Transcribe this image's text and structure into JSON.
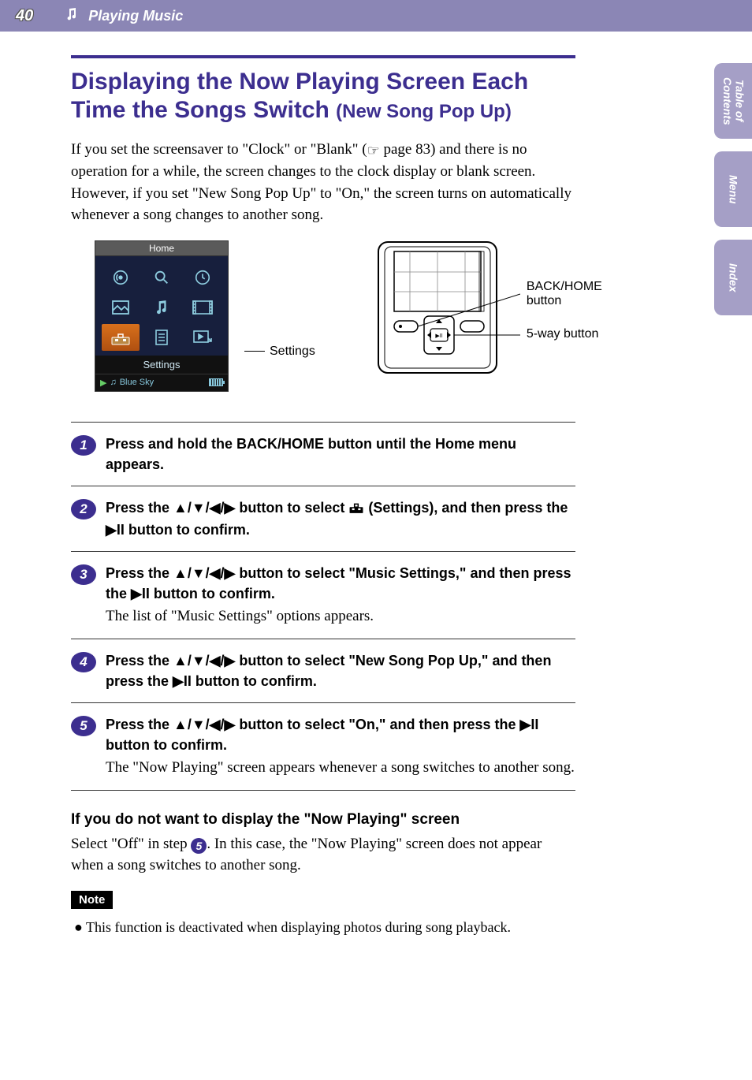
{
  "header": {
    "page_number": "40",
    "section_title": "Playing Music"
  },
  "side_tabs": {
    "toc": "Table of\nContents",
    "menu": "Menu",
    "index": "Index"
  },
  "title": {
    "main": "Displaying the Now Playing Screen Each Time the Songs Switch ",
    "sub": "(New Song Pop Up)"
  },
  "intro_a": "If you set the screensaver to \"Clock\" or \"Blank\" (",
  "intro_page_ref": " page 83",
  "intro_b": ") and there is no operation for a while, the screen changes to the clock display or blank screen. However, if you set \"New Song Pop Up\" to \"On,\" the screen turns on automatically whenever a song changes to another song.",
  "home_screen": {
    "top_label": "Home",
    "selected_label": "Settings",
    "status_track": "Blue Sky"
  },
  "callouts": {
    "settings": "Settings",
    "back_home_a": "BACK/HOME",
    "back_home_b": "button",
    "five_way": "5-way button"
  },
  "steps": [
    {
      "num": "1",
      "bold": "Press and hold the BACK/HOME button until the Home menu appears.",
      "regular": ""
    },
    {
      "num": "2",
      "bold_pre": "Press the ",
      "bold_mid": " button to select ",
      "bold_post": " (Settings), and then press the ",
      "bold_end": " button to confirm.",
      "regular": ""
    },
    {
      "num": "3",
      "bold_pre": "Press the ",
      "bold_mid": " button to select \"Music Settings,\" and then press the ",
      "bold_end": " button to confirm.",
      "regular": "The list of \"Music Settings\" options appears."
    },
    {
      "num": "4",
      "bold_pre": "Press the ",
      "bold_mid": " button to select \"New Song Pop Up,\" and then press the ",
      "bold_end": " button to confirm.",
      "regular": ""
    },
    {
      "num": "5",
      "bold_pre": "Press the ",
      "bold_mid": " button to select \"On,\" and then press the ",
      "bold_end": " button to confirm.",
      "regular": "The \"Now Playing\" screen appears whenever a song switches to another song."
    }
  ],
  "sub_section": {
    "heading": "If you do not want to display the \"Now Playing\" screen",
    "para_a": "Select \"Off\" in step ",
    "para_step": "5",
    "para_b": ". In this case, the \"Now Playing\" screen does not appear when a song switches to another song."
  },
  "note": {
    "label": "Note",
    "text": "This function is deactivated when displaying photos during song playback."
  }
}
